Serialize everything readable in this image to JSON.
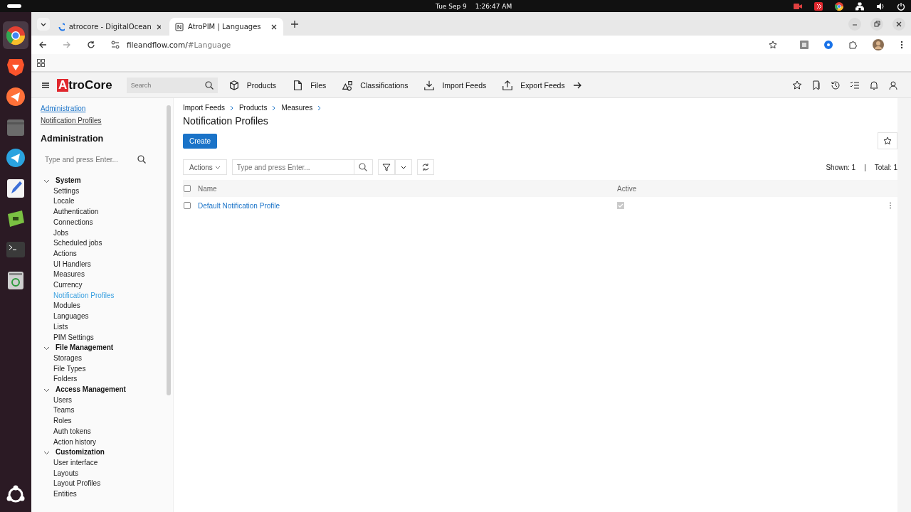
{
  "system_bar": {
    "date": "Tue Sep 9",
    "time": "1:26:47 AM"
  },
  "dock": [
    {
      "kind": "chrome",
      "selected": true
    },
    {
      "kind": "brave",
      "selected": false
    },
    {
      "kind": "firefox",
      "selected": false
    },
    {
      "kind": "files",
      "selected": false
    },
    {
      "kind": "telegram",
      "selected": false
    },
    {
      "kind": "editor",
      "selected": false
    },
    {
      "kind": "green",
      "selected": false
    },
    {
      "kind": "terminal",
      "selected": false
    },
    {
      "kind": "trash",
      "selected": false
    }
  ],
  "browser": {
    "tabs": [
      {
        "title": "atrocore - DigitalOcean",
        "selected": false
      },
      {
        "title": "AtroPIM | Languages",
        "selected": true
      }
    ],
    "url": {
      "host": "fileandflow.com/",
      "path": "#Language"
    }
  },
  "app": {
    "logo": {
      "mark": "A",
      "text": "troCore"
    },
    "search": {
      "placeholder": "Search"
    },
    "nav": [
      {
        "label": "Products",
        "kind": "box"
      },
      {
        "label": "Files",
        "kind": "file"
      },
      {
        "label": "Classifications",
        "kind": "shapes"
      },
      {
        "label": "Import Feeds",
        "kind": "import"
      },
      {
        "label": "Export Feeds",
        "kind": "export"
      }
    ]
  },
  "sidebar": {
    "links": [
      "Administration",
      "Notification Profiles"
    ],
    "title": "Administration",
    "search": {
      "placeholder": "Type and press Enter..."
    },
    "groups": [
      {
        "label": "System",
        "expanded": true,
        "items": [
          {
            "label": "Settings",
            "selected": false
          },
          {
            "label": "Locale",
            "selected": false
          },
          {
            "label": "Authentication",
            "selected": false
          },
          {
            "label": "Connections",
            "selected": false
          },
          {
            "label": "Jobs",
            "selected": false
          },
          {
            "label": "Scheduled jobs",
            "selected": false
          },
          {
            "label": "Actions",
            "selected": false
          },
          {
            "label": "UI Handlers",
            "selected": false
          },
          {
            "label": "Measures",
            "selected": false
          },
          {
            "label": "Currency",
            "selected": false
          },
          {
            "label": "Notification Profiles",
            "selected": true
          },
          {
            "label": "Modules",
            "selected": false
          },
          {
            "label": "Languages",
            "selected": false
          },
          {
            "label": "Lists",
            "selected": false
          },
          {
            "label": "PIM Settings",
            "selected": false
          }
        ]
      },
      {
        "label": "File Management",
        "expanded": true,
        "items": [
          {
            "label": "Storages",
            "selected": false
          },
          {
            "label": "File Types",
            "selected": false
          },
          {
            "label": "Folders",
            "selected": false
          }
        ]
      },
      {
        "label": "Access Management",
        "expanded": true,
        "items": [
          {
            "label": "Users",
            "selected": false
          },
          {
            "label": "Teams",
            "selected": false
          },
          {
            "label": "Roles",
            "selected": false
          },
          {
            "label": "Auth tokens",
            "selected": false
          },
          {
            "label": "Action history",
            "selected": false
          }
        ]
      },
      {
        "label": "Customization",
        "expanded": true,
        "items": [
          {
            "label": "User interface",
            "selected": false
          },
          {
            "label": "Layouts",
            "selected": false
          },
          {
            "label": "Layout Profiles",
            "selected": false
          },
          {
            "label": "Entities",
            "selected": false
          }
        ]
      }
    ]
  },
  "content": {
    "breadcrumbs": [
      "Import Feeds",
      "Products",
      "Measures"
    ],
    "title": "Notification Profiles",
    "create_button": "Create",
    "actions": "Actions",
    "search": {
      "placeholder": "Type and press Enter..."
    },
    "shown": "Shown: 1",
    "separator": "|",
    "total": "Total: 1",
    "table": {
      "all_selected": false,
      "columns": [
        "Name",
        "Active"
      ],
      "rows": [
        {
          "name": "Default Notification Profile",
          "active": true,
          "selected": false
        }
      ]
    }
  }
}
